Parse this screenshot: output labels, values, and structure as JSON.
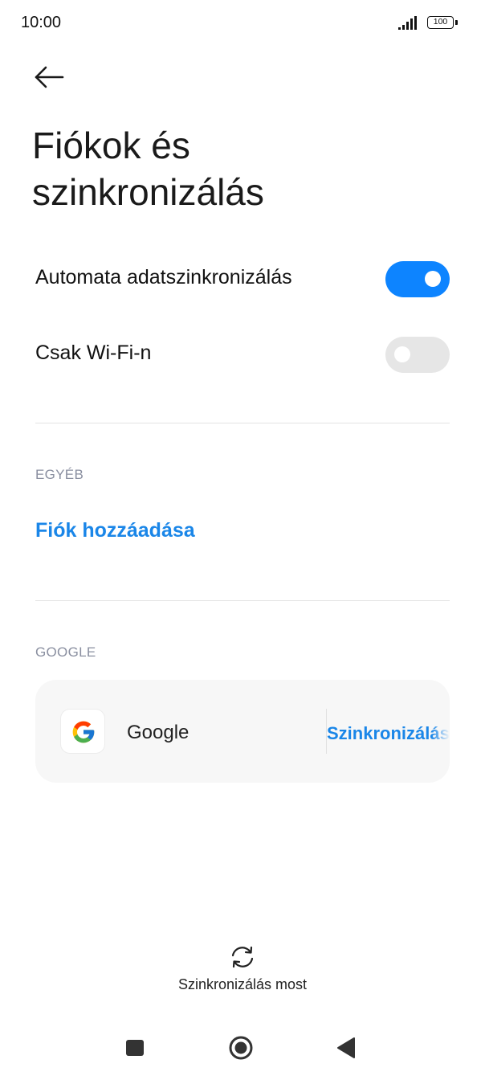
{
  "status_bar": {
    "time": "10:00",
    "battery": "100"
  },
  "header": {
    "back_icon": "arrow-left-icon",
    "title_line1": "Fiókok és",
    "title_line2": "szinkronizálás"
  },
  "settings": {
    "auto_sync": {
      "label": "Automata adatszinkronizálás",
      "enabled": true
    },
    "wifi_only": {
      "label": "Csak Wi-Fi-n",
      "enabled": false
    }
  },
  "other_section": {
    "header": "EGYÉB",
    "add_account_label": "Fiók hozzáadása"
  },
  "google_section": {
    "header": "GOOGLE",
    "account": {
      "icon": "google-logo-icon",
      "name": "Google",
      "action_label": "Szinkronizálás"
    }
  },
  "footer": {
    "sync_now_icon": "sync-icon",
    "sync_now_label": "Szinkronizálás most"
  },
  "navigation": {
    "recents_icon": "square-icon",
    "home_icon": "circle-icon",
    "back_icon": "triangle-back-icon"
  },
  "colors": {
    "accent": "#0d84ff",
    "link": "#1a86e8",
    "toggle_off": "#e6e6e6",
    "section_header": "#8a8fa0",
    "card_background": "#f7f7f7"
  }
}
